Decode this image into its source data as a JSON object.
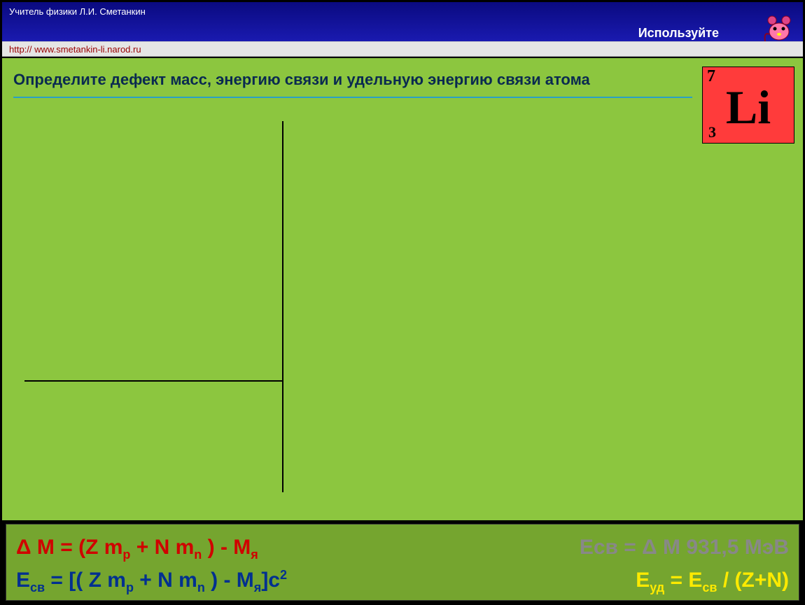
{
  "header": {
    "teacher": "Учитель физики Л.И. Сметанкин",
    "hint": "Используйте"
  },
  "link": {
    "url_text": "http:// www.smetankin-li.narod.ru"
  },
  "task": {
    "text": "Определите  дефект масс, энергию связи и удельную энергию связи атома"
  },
  "element": {
    "mass": "7",
    "number": "3",
    "symbol": "Li"
  },
  "formulas": {
    "dm_label": "Δ M = (Z m",
    "dm_sub1": "p",
    "dm_mid": " + N m",
    "dm_sub2": "n",
    "dm_end": " ) - M",
    "dm_sub3": "я",
    "e_sv_gray_pre": "Eсв  = Δ M 931,5 МэВ",
    "e_sv_blue_a": "E",
    "e_sv_blue_sub": "св",
    "e_sv_blue_b": " = [( Z m",
    "e_sv_blue_sub2": "p",
    "e_sv_blue_c": " + N m",
    "e_sv_blue_sub3": "n",
    "e_sv_blue_d": " ) - M",
    "e_sv_blue_sub4": "я",
    "e_sv_blue_e": "]c",
    "e_sv_blue_sup": "2",
    "e_ud_a": "E",
    "e_ud_sub1": "уд",
    "e_ud_b": " = E",
    "e_ud_sub2": "св",
    "e_ud_c": " / (Z+N)"
  }
}
